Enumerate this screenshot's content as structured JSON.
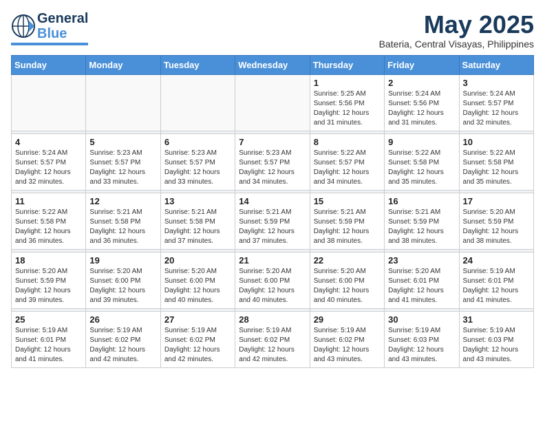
{
  "logo": {
    "text1": "General",
    "text2": "Blue",
    "accent": "#4a90d9"
  },
  "title": "May 2025",
  "subtitle": "Bateria, Central Visayas, Philippines",
  "days_of_week": [
    "Sunday",
    "Monday",
    "Tuesday",
    "Wednesday",
    "Thursday",
    "Friday",
    "Saturday"
  ],
  "weeks": [
    [
      {
        "num": "",
        "info": ""
      },
      {
        "num": "",
        "info": ""
      },
      {
        "num": "",
        "info": ""
      },
      {
        "num": "",
        "info": ""
      },
      {
        "num": "1",
        "info": "Sunrise: 5:25 AM\nSunset: 5:56 PM\nDaylight: 12 hours\nand 31 minutes."
      },
      {
        "num": "2",
        "info": "Sunrise: 5:24 AM\nSunset: 5:56 PM\nDaylight: 12 hours\nand 31 minutes."
      },
      {
        "num": "3",
        "info": "Sunrise: 5:24 AM\nSunset: 5:57 PM\nDaylight: 12 hours\nand 32 minutes."
      }
    ],
    [
      {
        "num": "4",
        "info": "Sunrise: 5:24 AM\nSunset: 5:57 PM\nDaylight: 12 hours\nand 32 minutes."
      },
      {
        "num": "5",
        "info": "Sunrise: 5:23 AM\nSunset: 5:57 PM\nDaylight: 12 hours\nand 33 minutes."
      },
      {
        "num": "6",
        "info": "Sunrise: 5:23 AM\nSunset: 5:57 PM\nDaylight: 12 hours\nand 33 minutes."
      },
      {
        "num": "7",
        "info": "Sunrise: 5:23 AM\nSunset: 5:57 PM\nDaylight: 12 hours\nand 34 minutes."
      },
      {
        "num": "8",
        "info": "Sunrise: 5:22 AM\nSunset: 5:57 PM\nDaylight: 12 hours\nand 34 minutes."
      },
      {
        "num": "9",
        "info": "Sunrise: 5:22 AM\nSunset: 5:58 PM\nDaylight: 12 hours\nand 35 minutes."
      },
      {
        "num": "10",
        "info": "Sunrise: 5:22 AM\nSunset: 5:58 PM\nDaylight: 12 hours\nand 35 minutes."
      }
    ],
    [
      {
        "num": "11",
        "info": "Sunrise: 5:22 AM\nSunset: 5:58 PM\nDaylight: 12 hours\nand 36 minutes."
      },
      {
        "num": "12",
        "info": "Sunrise: 5:21 AM\nSunset: 5:58 PM\nDaylight: 12 hours\nand 36 minutes."
      },
      {
        "num": "13",
        "info": "Sunrise: 5:21 AM\nSunset: 5:58 PM\nDaylight: 12 hours\nand 37 minutes."
      },
      {
        "num": "14",
        "info": "Sunrise: 5:21 AM\nSunset: 5:59 PM\nDaylight: 12 hours\nand 37 minutes."
      },
      {
        "num": "15",
        "info": "Sunrise: 5:21 AM\nSunset: 5:59 PM\nDaylight: 12 hours\nand 38 minutes."
      },
      {
        "num": "16",
        "info": "Sunrise: 5:21 AM\nSunset: 5:59 PM\nDaylight: 12 hours\nand 38 minutes."
      },
      {
        "num": "17",
        "info": "Sunrise: 5:20 AM\nSunset: 5:59 PM\nDaylight: 12 hours\nand 38 minutes."
      }
    ],
    [
      {
        "num": "18",
        "info": "Sunrise: 5:20 AM\nSunset: 5:59 PM\nDaylight: 12 hours\nand 39 minutes."
      },
      {
        "num": "19",
        "info": "Sunrise: 5:20 AM\nSunset: 6:00 PM\nDaylight: 12 hours\nand 39 minutes."
      },
      {
        "num": "20",
        "info": "Sunrise: 5:20 AM\nSunset: 6:00 PM\nDaylight: 12 hours\nand 40 minutes."
      },
      {
        "num": "21",
        "info": "Sunrise: 5:20 AM\nSunset: 6:00 PM\nDaylight: 12 hours\nand 40 minutes."
      },
      {
        "num": "22",
        "info": "Sunrise: 5:20 AM\nSunset: 6:00 PM\nDaylight: 12 hours\nand 40 minutes."
      },
      {
        "num": "23",
        "info": "Sunrise: 5:20 AM\nSunset: 6:01 PM\nDaylight: 12 hours\nand 41 minutes."
      },
      {
        "num": "24",
        "info": "Sunrise: 5:19 AM\nSunset: 6:01 PM\nDaylight: 12 hours\nand 41 minutes."
      }
    ],
    [
      {
        "num": "25",
        "info": "Sunrise: 5:19 AM\nSunset: 6:01 PM\nDaylight: 12 hours\nand 41 minutes."
      },
      {
        "num": "26",
        "info": "Sunrise: 5:19 AM\nSunset: 6:02 PM\nDaylight: 12 hours\nand 42 minutes."
      },
      {
        "num": "27",
        "info": "Sunrise: 5:19 AM\nSunset: 6:02 PM\nDaylight: 12 hours\nand 42 minutes."
      },
      {
        "num": "28",
        "info": "Sunrise: 5:19 AM\nSunset: 6:02 PM\nDaylight: 12 hours\nand 42 minutes."
      },
      {
        "num": "29",
        "info": "Sunrise: 5:19 AM\nSunset: 6:02 PM\nDaylight: 12 hours\nand 43 minutes."
      },
      {
        "num": "30",
        "info": "Sunrise: 5:19 AM\nSunset: 6:03 PM\nDaylight: 12 hours\nand 43 minutes."
      },
      {
        "num": "31",
        "info": "Sunrise: 5:19 AM\nSunset: 6:03 PM\nDaylight: 12 hours\nand 43 minutes."
      }
    ]
  ]
}
